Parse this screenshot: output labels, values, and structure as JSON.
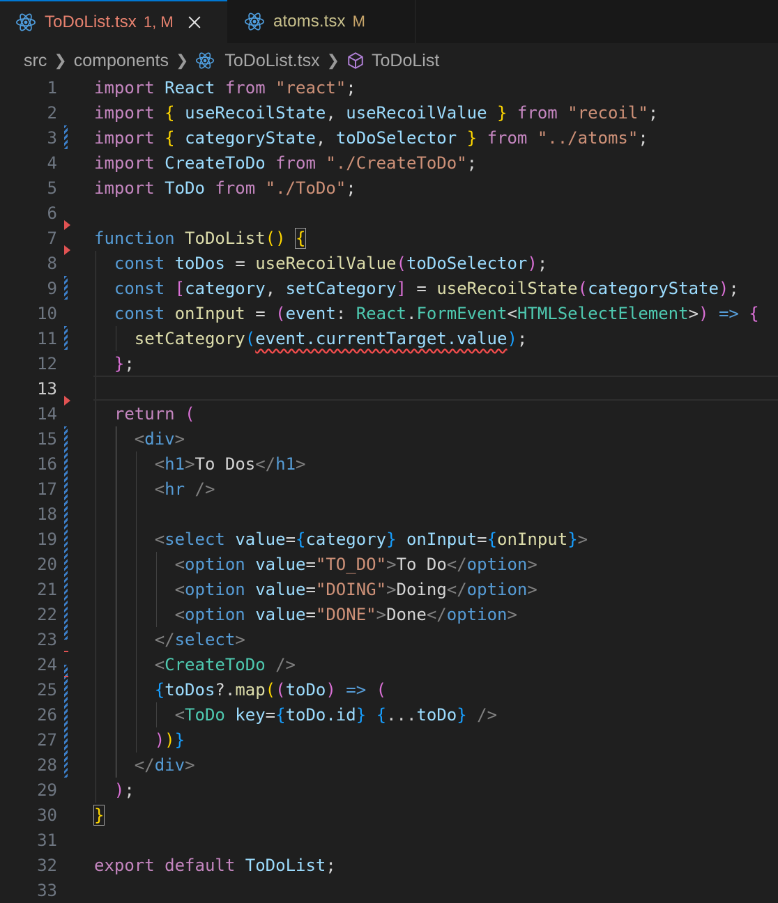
{
  "tabs": [
    {
      "name": "ToDoList.tsx",
      "badge": "1, M",
      "active": true
    },
    {
      "name": "atoms.tsx",
      "badge": "M",
      "active": false
    }
  ],
  "breadcrumb": [
    "src",
    "components",
    "ToDoList.tsx",
    "ToDoList"
  ],
  "icons": {
    "file_icon": "react-icon",
    "symbol_icon": "cube-icon",
    "close_icon": "close-icon"
  },
  "colors": {
    "accent": "#0078d4",
    "modified_tab": "#e8826f",
    "keyword": "#c586c0",
    "string": "#ce9178",
    "type": "#4ec9b0",
    "variable": "#9cdcfe",
    "function": "#dcdcaa",
    "error": "#f14c4c"
  },
  "editor": {
    "current_line": 13,
    "line_numbers": [
      "1",
      "2",
      "3",
      "4",
      "5",
      "6",
      "7",
      "8",
      "9",
      "10",
      "11",
      "12",
      "13",
      "14",
      "15",
      "16",
      "17",
      "18",
      "19",
      "20",
      "21",
      "22",
      "23",
      "24",
      "25",
      "26",
      "27",
      "28",
      "29",
      "30",
      "31",
      "32",
      "33"
    ],
    "code": {
      "l1": [
        "import",
        "React",
        "from",
        "\"react\"",
        ";"
      ],
      "l2": [
        "import",
        "{",
        "useRecoilState",
        ",",
        "useRecoilValue",
        "}",
        "from",
        "\"recoil\"",
        ";"
      ],
      "l3": [
        "import",
        "{",
        "categoryState",
        ",",
        "toDoSelector",
        "}",
        "from",
        "\"../atoms\"",
        ";"
      ],
      "l4": [
        "import",
        "CreateToDo",
        "from",
        "\"./CreateToDo\"",
        ";"
      ],
      "l5": [
        "import",
        "ToDo",
        "from",
        "\"./ToDo\"",
        ";"
      ],
      "l7": [
        "function",
        "ToDoList",
        "()",
        "{"
      ],
      "l8": [
        "const",
        "toDos",
        "=",
        "useRecoilValue",
        "(",
        "toDoSelector",
        ")",
        ";"
      ],
      "l9": [
        "const",
        "[",
        "category",
        ",",
        "setCategory",
        "]",
        "=",
        "useRecoilState",
        "(",
        "categoryState",
        ")",
        ";"
      ],
      "l10": [
        "const",
        "onInput",
        "=",
        "(",
        "event",
        ":",
        "React",
        ".",
        "FormEvent",
        "<",
        "HTMLSelectElement",
        ">",
        ")",
        "=>",
        "{"
      ],
      "l11": [
        "setCategory",
        "(",
        "event.currentTarget.value",
        ")",
        ";"
      ],
      "l12": [
        "}",
        ";"
      ],
      "l14": [
        "return",
        "("
      ],
      "l15": [
        "<",
        "div",
        ">"
      ],
      "l16": [
        "<",
        "h1",
        ">",
        "To Dos",
        "</",
        "h1",
        ">"
      ],
      "l17": [
        "<",
        "hr",
        "/>"
      ],
      "l19": [
        "<",
        "select",
        "value",
        "=",
        "{",
        "category",
        "}",
        "onInput",
        "=",
        "{",
        "onInput",
        "}",
        ">"
      ],
      "l20": [
        "<",
        "option",
        "value",
        "=",
        "\"TO_DO\"",
        ">",
        "To Do",
        "</",
        "option",
        ">"
      ],
      "l21": [
        "<",
        "option",
        "value",
        "=",
        "\"DOING\"",
        ">",
        "Doing",
        "</",
        "option",
        ">"
      ],
      "l22": [
        "<",
        "option",
        "value",
        "=",
        "\"DONE\"",
        ">",
        "Done",
        "</",
        "option",
        ">"
      ],
      "l23": [
        "</",
        "select",
        ">"
      ],
      "l24": [
        "<",
        "CreateToDo",
        "/>"
      ],
      "l25": [
        "{",
        "toDos",
        "?.",
        "map",
        "(",
        "(",
        "toDo",
        ")",
        "=>",
        "("
      ],
      "l26": [
        "<",
        "ToDo",
        "key",
        "=",
        "{",
        "toDo.id",
        "}",
        "{",
        "...",
        "toDo",
        "}",
        "/>"
      ],
      "l27": [
        ")",
        ")",
        "}"
      ],
      "l28": [
        "</",
        "div",
        ">"
      ],
      "l29": [
        ")",
        ";"
      ],
      "l30": [
        "}"
      ],
      "l32": [
        "export",
        "default",
        "ToDoList",
        ";"
      ]
    }
  }
}
